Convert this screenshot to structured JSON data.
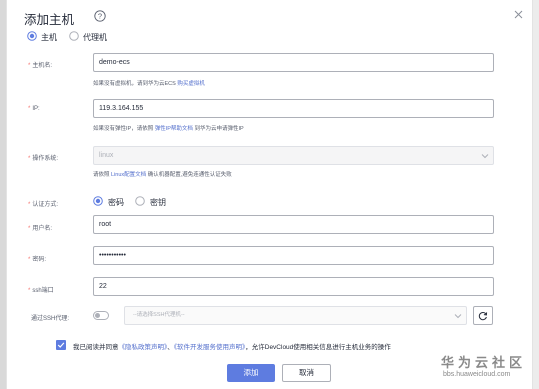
{
  "dialog": {
    "title": "添加主机",
    "host_types": [
      {
        "label": "主机",
        "selected": true
      },
      {
        "label": "代理机",
        "selected": false
      }
    ],
    "fields": {
      "hostname": {
        "label": "主机名:",
        "value": "demo-ecs"
      },
      "hostname_hint": {
        "text": "如果没有虚拟机，请到华为云ECS ",
        "link": "购买虚拟机"
      },
      "ip": {
        "label": "IP:",
        "value": "119.3.164.155"
      },
      "ip_hint": {
        "text_before": "如果没有弹性IP，请依照 ",
        "link": "弹性IP帮助文档",
        "text_after": " 到华为云申请弹性IP"
      },
      "os": {
        "label": "操作系统:",
        "value": "linux"
      },
      "os_hint": {
        "text_before": "请依照 ",
        "link": "Linux配置文档",
        "text_after": " 确认机器配置,避免连通性认证失败"
      },
      "auth": {
        "label": "认证方式:",
        "options": [
          {
            "label": "密码",
            "selected": true
          },
          {
            "label": "密钥",
            "selected": false
          }
        ]
      },
      "username": {
        "label": "用户名:",
        "value": "root"
      },
      "password": {
        "label": "密码:",
        "value": "•••••••••••"
      },
      "ssh_port": {
        "label": "ssh端口",
        "value": "22"
      },
      "ssh_proxy": {
        "label": "通过SSH代理:",
        "enabled": false,
        "placeholder": "--请选择SSH代理机--"
      }
    },
    "agreement": {
      "checked": true,
      "text_before": "我已阅读并同意",
      "privacy_link": "《隐私政策声明》",
      "separator": "、",
      "service_link": "《软件开发服务使用声明》",
      "text_after": "，允许DevCloud使用相关信息进行主机业务的操作"
    },
    "buttons": {
      "confirm": "添加",
      "cancel": "取消"
    }
  },
  "watermark": {
    "title": "华为云社区",
    "url": "bbs.huaweicloud.com"
  },
  "colors": {
    "accent": "#5e7ce0",
    "link": "#526ecc",
    "required": "#f66f6a"
  }
}
